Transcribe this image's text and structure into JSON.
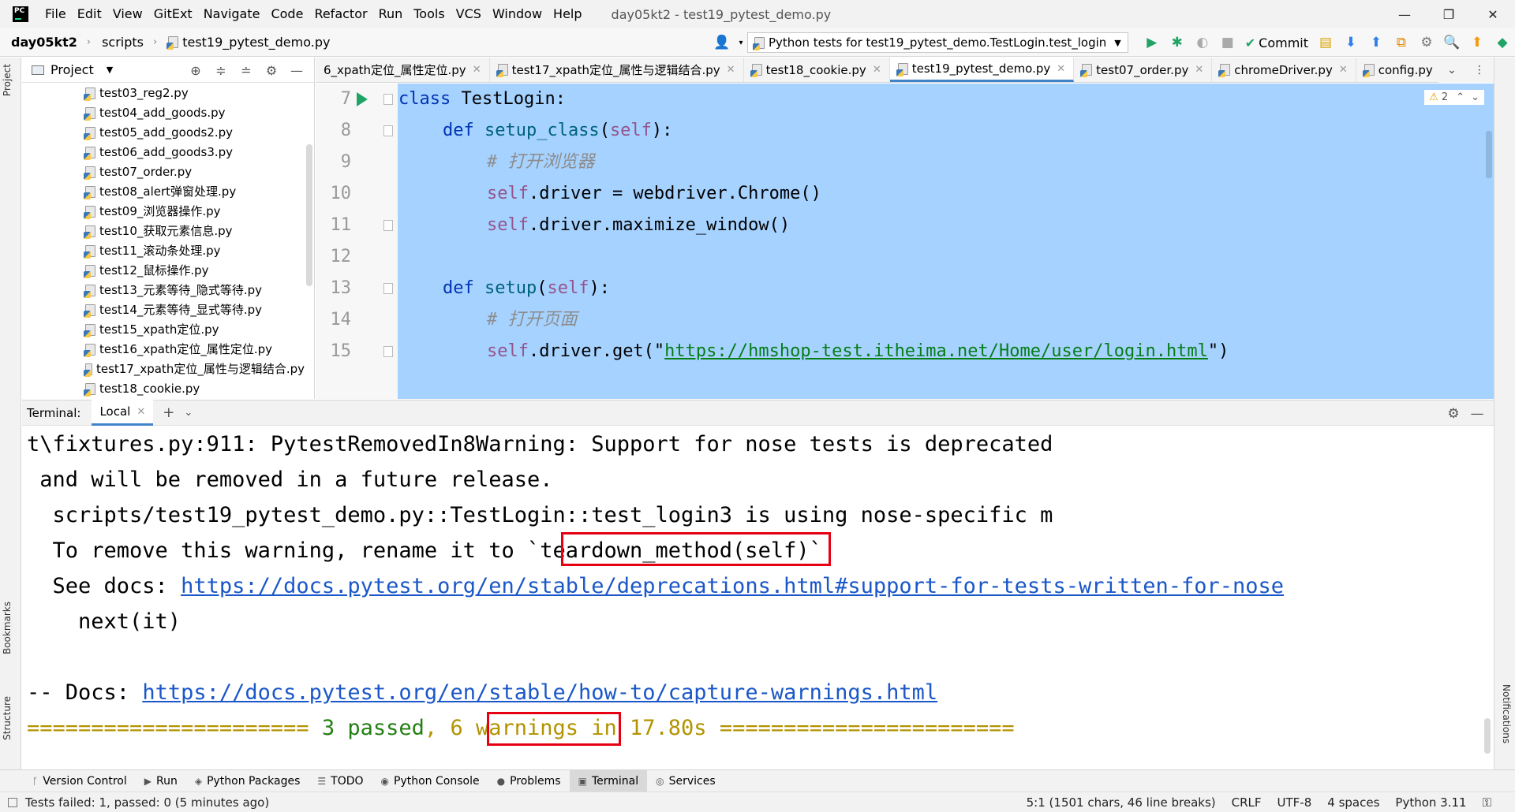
{
  "window": {
    "title": "day05kt2 - test19_pytest_demo.py",
    "controls": [
      "—",
      "❐",
      "✕"
    ]
  },
  "menu": [
    "File",
    "Edit",
    "View",
    "GitExt",
    "Navigate",
    "Code",
    "Refactor",
    "Run",
    "Tools",
    "VCS",
    "Window",
    "Help"
  ],
  "nav": {
    "project": "day05kt2",
    "folder": "scripts",
    "file": "test19_pytest_demo.py",
    "run_config": "Python tests for test19_pytest_demo.TestLogin.test_login",
    "commit": "Commit"
  },
  "left_strip": {
    "project": "Project",
    "bookmarks": "Bookmarks",
    "structure": "Structure"
  },
  "right_strip": {
    "notifications": "Notifications"
  },
  "project_panel": {
    "title": "Project",
    "files": [
      "test03_reg2.py",
      "test04_add_goods.py",
      "test05_add_goods2.py",
      "test06_add_goods3.py",
      "test07_order.py",
      "test08_alert弹窗处理.py",
      "test09_浏览器操作.py",
      "test10_获取元素信息.py",
      "test11_滚动条处理.py",
      "test12_鼠标操作.py",
      "test13_元素等待_隐式等待.py",
      "test14_元素等待_显式等待.py",
      "test15_xpath定位.py",
      "test16_xpath定位_属性定位.py",
      "test17_xpath定位_属性与逻辑结合.py",
      "test18_cookie.py"
    ]
  },
  "editor": {
    "tabs": [
      {
        "label": "6_xpath定位_属性定位.py",
        "active": false
      },
      {
        "label": "test17_xpath定位_属性与逻辑结合.py",
        "active": false
      },
      {
        "label": "test18_cookie.py",
        "active": false
      },
      {
        "label": "test19_pytest_demo.py",
        "active": true
      },
      {
        "label": "test07_order.py",
        "active": false
      },
      {
        "label": "chromeDriver.py",
        "active": false
      },
      {
        "label": "config.py",
        "active": false
      }
    ],
    "warning_count": "2",
    "line_numbers": [
      "7",
      "8",
      "9",
      "10",
      "11",
      "12",
      "13",
      "14",
      "15"
    ],
    "code": {
      "l7_kw": "class ",
      "l7_name": "TestLogin:",
      "l8_kw": "def ",
      "l8_fn": "setup_class",
      "l8_open": "(",
      "l8_self": "self",
      "l8_close": "):",
      "l9": "# 打开浏览器",
      "l10_self": "self",
      "l10_rest": ".driver = webdriver.Chrome()",
      "l11_self": "self",
      "l11_rest": ".driver.maximize_window()",
      "l13_kw": "def ",
      "l13_fn": "setup",
      "l13_open": "(",
      "l13_self": "self",
      "l13_close": "):",
      "l14": "# 打开页面",
      "l15_self": "self",
      "l15_pre": ".driver.get(\"",
      "l15_url": "https://hmshop-test.itheima.net/Home/user/login.html",
      "l15_post": "\")"
    }
  },
  "terminal": {
    "title": "Terminal:",
    "tab": "Local",
    "lines": {
      "l1": "t\\fixtures.py:911: PytestRemovedIn8Warning: Support for nose tests is deprecated",
      "l2": " and will be removed in a future release.",
      "l3": "  scripts/test19_pytest_demo.py::TestLogin::test_login3 is using nose-specific m",
      "l4_pre": "  To remove this warning, rename it to ",
      "l4_code": "`teardown_method(self)`",
      "l5_pre": "  See docs: ",
      "l5_url": "https://docs.pytest.org/en/stable/deprecations.html#support-for-tests-written-for-nose",
      "l6": "    next(it)",
      "l8_pre": "-- Docs: ",
      "l8_url": "https://docs.pytest.org/en/stable/how-to/capture-warnings.html",
      "l9_eq1": "====================== ",
      "l9_passed": "3 passed",
      "l9_comma": ", ",
      "l9_warn": "6 warnings",
      "l9_time": " in 17.80s",
      "l9_eq2": " ======================="
    }
  },
  "bottom_tools": [
    {
      "label": "Version Control",
      "icon": "ᚴ",
      "active": false
    },
    {
      "label": "Run",
      "icon": "▶",
      "active": false
    },
    {
      "label": "Python Packages",
      "icon": "◈",
      "active": false
    },
    {
      "label": "TODO",
      "icon": "☰",
      "active": false
    },
    {
      "label": "Python Console",
      "icon": "◉",
      "active": false
    },
    {
      "label": "Problems",
      "icon": "●",
      "active": false
    },
    {
      "label": "Terminal",
      "icon": "▣",
      "active": true
    },
    {
      "label": "Services",
      "icon": "◎",
      "active": false
    }
  ],
  "status": {
    "left": "Tests failed: 1, passed: 0 (5 minutes ago)",
    "position": "5:1 (1501 chars, 46 line breaks)",
    "line_sep": "CRLF",
    "encoding": "UTF-8",
    "indent": "4 spaces",
    "interpreter": "Python 3.11"
  }
}
